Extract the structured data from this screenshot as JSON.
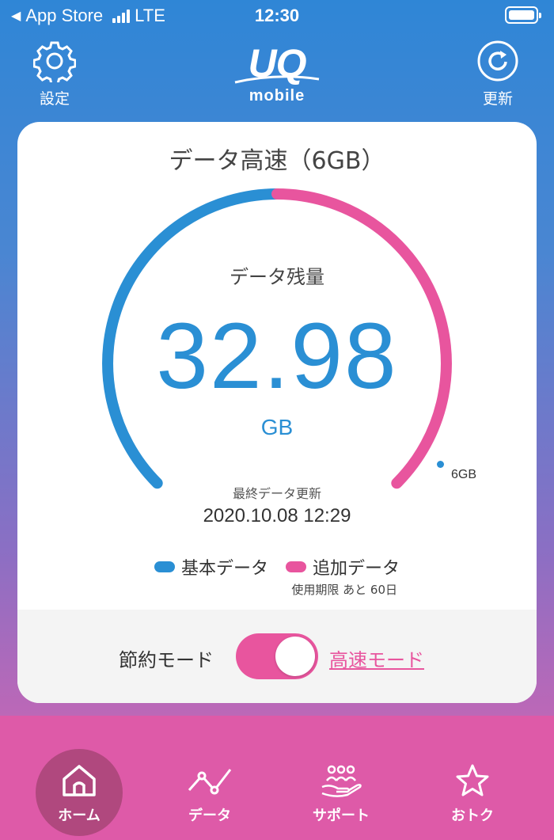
{
  "status_bar": {
    "back_app": "App Store",
    "network": "LTE",
    "time": "12:30"
  },
  "header": {
    "settings_label": "設定",
    "refresh_label": "更新",
    "logo_top": "UQ",
    "logo_bottom": "mobile"
  },
  "card": {
    "title": "データ高速（6GB）",
    "remaining_label": "データ残量",
    "remaining_value": "32.98",
    "remaining_unit": "GB",
    "capacity_marker": "6GB",
    "updated_label": "最終データ更新",
    "updated_value": "2020.10.08 12:29",
    "gauge": {
      "basic_fraction": 0.5,
      "additional_fraction": 0.5
    },
    "legend": {
      "basic_label": "基本データ",
      "additional_label": "追加データ",
      "expiry": "使用期限 あと 60日"
    },
    "mode": {
      "saving_label": "節約モード",
      "fast_label": "高速モード",
      "fast_enabled": true
    }
  },
  "colors": {
    "basic": "#2a8fd4",
    "additional": "#e8559e"
  },
  "tabs": [
    {
      "label": "ホーム",
      "icon": "home-icon",
      "active": true
    },
    {
      "label": "データ",
      "icon": "chart-line-icon",
      "active": false
    },
    {
      "label": "サポート",
      "icon": "support-hand-icon",
      "active": false
    },
    {
      "label": "おトク",
      "icon": "star-icon",
      "active": false
    }
  ]
}
